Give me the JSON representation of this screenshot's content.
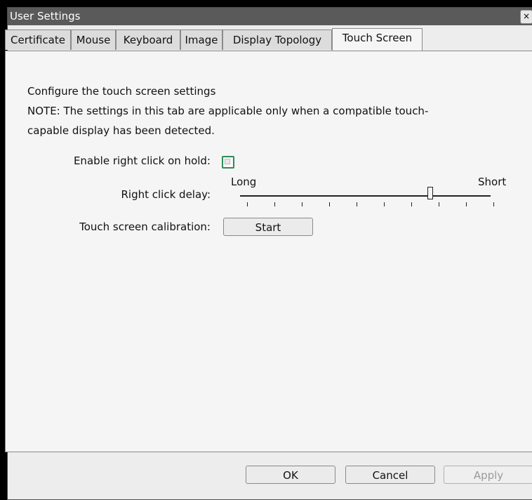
{
  "window": {
    "title": "User Settings",
    "close_icon": "×"
  },
  "tabs": [
    {
      "label": "Certificate"
    },
    {
      "label": "Mouse"
    },
    {
      "label": "Keyboard"
    },
    {
      "label": "Image"
    },
    {
      "label": "Display Topology"
    },
    {
      "label": "Touch Screen",
      "active": true
    }
  ],
  "touch_screen": {
    "description_line1": "Configure the touch screen settings",
    "description_line2": "NOTE: The settings in this tab are applicable only when a compatible touch-",
    "description_line3": "capable display has been detected.",
    "enable_right_click_label": "Enable right click on hold:",
    "enable_right_click_checked": false,
    "right_click_delay_label": "Right click delay:",
    "slider_min_label": "Long",
    "slider_max_label": "Short",
    "slider_tick_count": 10,
    "slider_value_fraction": 0.76,
    "calibration_label": "Touch screen calibration:",
    "calibration_button": "Start"
  },
  "footer": {
    "ok": "OK",
    "cancel": "Cancel",
    "apply": "Apply"
  },
  "colors": {
    "titlebar": "#5a5a5a",
    "checkbox_border": "#2e8b57",
    "panel": "#f5f5f5"
  }
}
